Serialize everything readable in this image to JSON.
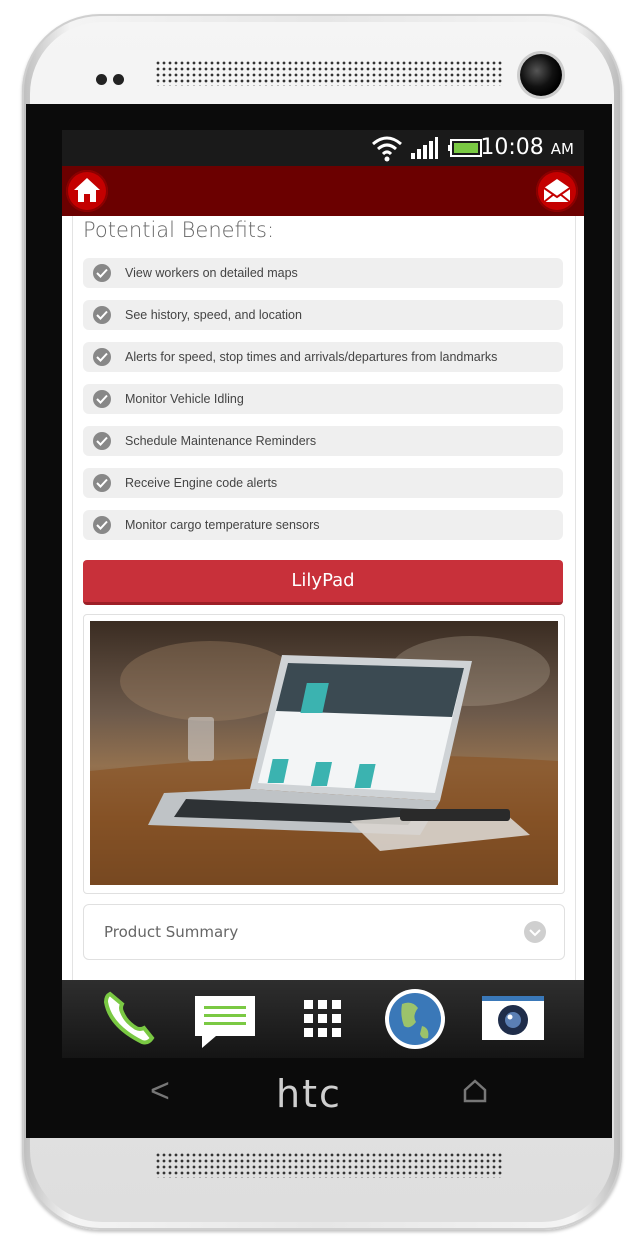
{
  "status_bar": {
    "time": "10:08",
    "ampm": "AM"
  },
  "section": {
    "title": "Potential Benefits:"
  },
  "benefits": [
    "View workers on detailed maps",
    "See history, speed, and location",
    "Alerts for speed, stop times and arrivals/departures from landmarks",
    "Monitor Vehicle Idling",
    "Schedule Maintenance Reminders",
    "Receive Engine code alerts",
    "Monitor cargo temperature sensors"
  ],
  "primary_button": {
    "label": "LilyPad"
  },
  "accordion": {
    "label": "Product Summary"
  },
  "device": {
    "brand": "htc",
    "back_glyph": "<"
  },
  "colors": {
    "app_bar": "#6b0000",
    "accent": "#c8303a",
    "home_button": "#c40000"
  }
}
